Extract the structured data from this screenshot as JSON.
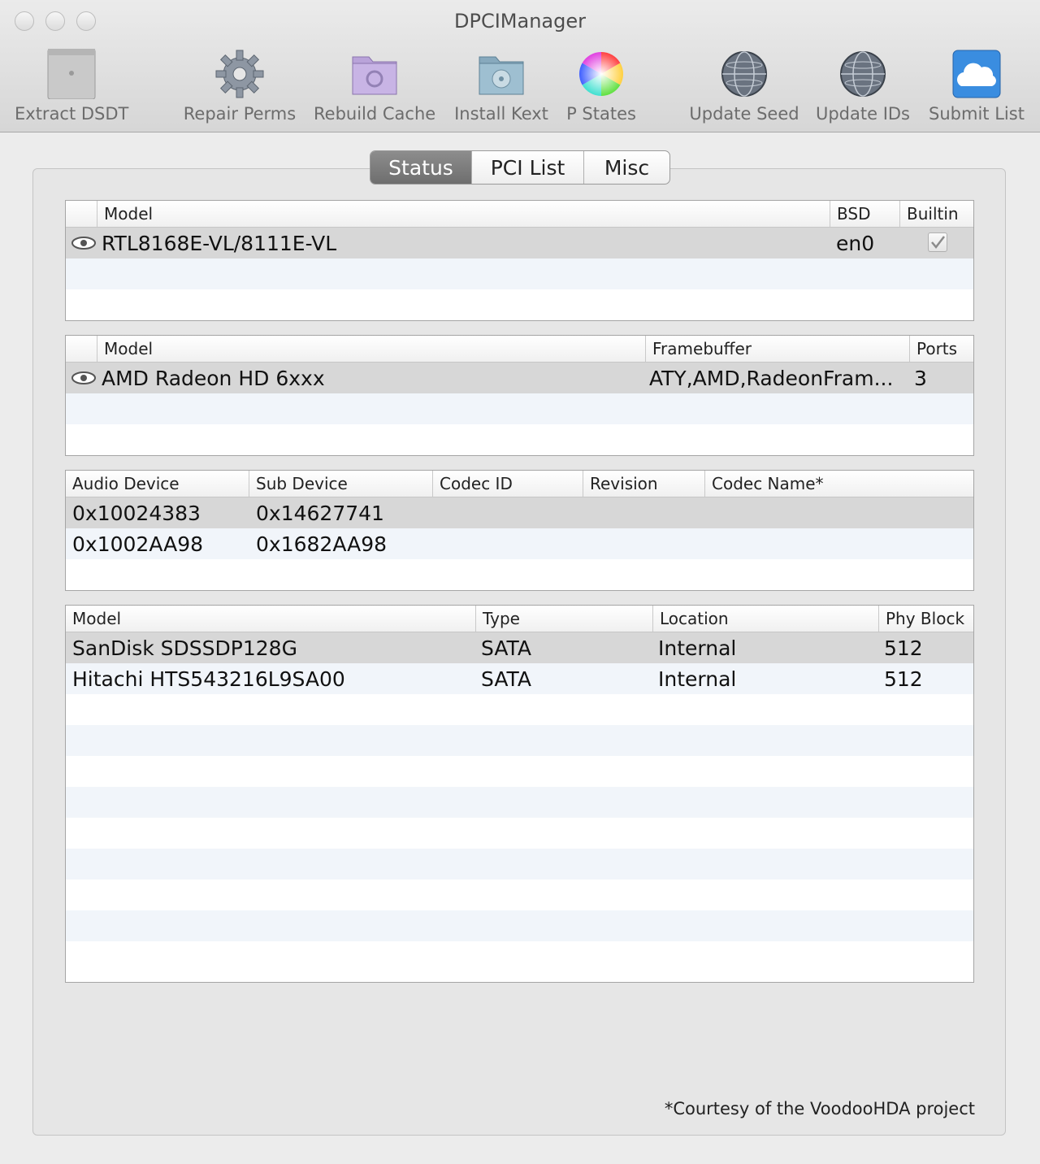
{
  "window": {
    "title": "DPCIManager"
  },
  "toolbar": {
    "items": [
      {
        "label": "Extract DSDT",
        "icon": "mac-pro-icon"
      },
      {
        "label": "Repair Perms",
        "icon": "gear-icon"
      },
      {
        "label": "Rebuild Cache",
        "icon": "folder-gear-icon"
      },
      {
        "label": "Install Kext",
        "icon": "folder-radiation-icon"
      },
      {
        "label": "P States",
        "icon": "color-wheel-icon"
      },
      {
        "label": "Update Seed",
        "icon": "globe-icon"
      },
      {
        "label": "Update IDs",
        "icon": "globe-icon"
      },
      {
        "label": "Submit List",
        "icon": "cloud-icon"
      }
    ]
  },
  "tabs": [
    {
      "label": "Status",
      "active": true
    },
    {
      "label": "PCI List",
      "active": false
    },
    {
      "label": "Misc",
      "active": false
    }
  ],
  "network": {
    "headers": {
      "model": "Model",
      "bsd": "BSD",
      "builtin": "Builtin"
    },
    "rows": [
      {
        "model": "RTL8168E-VL/8111E-VL",
        "bsd": "en0",
        "builtin": true
      }
    ]
  },
  "graphics": {
    "headers": {
      "model": "Model",
      "framebuffer": "Framebuffer",
      "ports": "Ports"
    },
    "rows": [
      {
        "model": "AMD Radeon HD 6xxx",
        "framebuffer": "ATY,AMD,RadeonFram...",
        "ports": "3"
      }
    ]
  },
  "audio": {
    "headers": {
      "device": "Audio Device",
      "subdevice": "Sub Device",
      "codec_id": "Codec ID",
      "revision": "Revision",
      "codec_name": "Codec Name*"
    },
    "rows": [
      {
        "device": "0x10024383",
        "subdevice": "0x14627741"
      },
      {
        "device": "0x1002AA98",
        "subdevice": "0x1682AA98"
      }
    ]
  },
  "storage": {
    "headers": {
      "model": "Model",
      "type": "Type",
      "location": "Location",
      "phy_block": "Phy Block"
    },
    "rows": [
      {
        "model": "SanDisk SDSSDP128G",
        "type": "SATA",
        "location": "Internal",
        "phy_block": "512"
      },
      {
        "model": "Hitachi HTS543216L9SA00",
        "type": "SATA",
        "location": "Internal",
        "phy_block": "512"
      }
    ]
  },
  "footnote": "*Courtesy of the VoodooHDA project"
}
